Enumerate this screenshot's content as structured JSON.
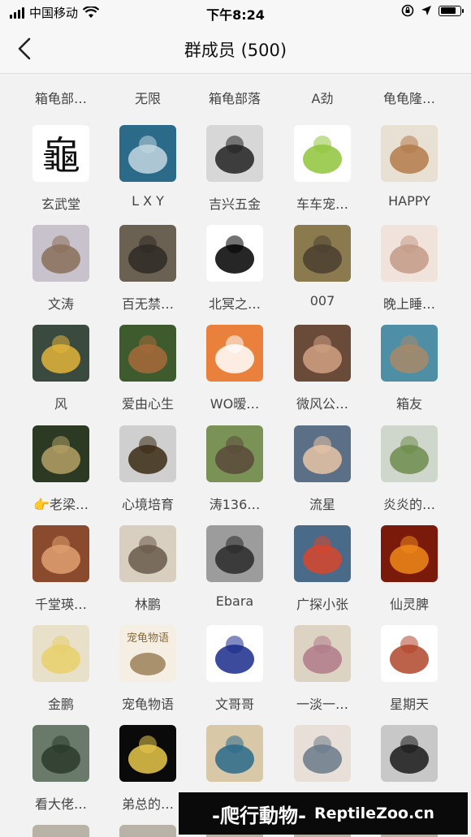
{
  "status_bar": {
    "carrier": "中国移动",
    "time": "下午8:24",
    "signal_bars": 4,
    "battery_level": 0.85
  },
  "nav": {
    "title": "群成员 (500)",
    "back_icon": "chevron-left-icon"
  },
  "members_top_partial": [
    "箱龟部…",
    "无限",
    "箱龟部落",
    "A劲",
    "龟龟隆…"
  ],
  "member_rows": [
    [
      {
        "name": "玄武堂",
        "colors": [
          "#ffffff",
          "#111111"
        ],
        "glyph": "龜"
      },
      {
        "name": "L X Y",
        "colors": [
          "#2b6a88",
          "#c3d7e0"
        ]
      },
      {
        "name": "吉兴五金",
        "colors": [
          "#d7d7d7",
          "#222222"
        ]
      },
      {
        "name": "车车宠…",
        "colors": [
          "#ffffff",
          "#8fc43a"
        ]
      },
      {
        "name": "HAPPY",
        "colors": [
          "#e7e0d3",
          "#b47a4a"
        ]
      }
    ],
    [
      {
        "name": "文涛",
        "colors": [
          "#c7c2cb",
          "#8a6f5a"
        ]
      },
      {
        "name": "百无禁…",
        "colors": [
          "#6b6152",
          "#2f2a26"
        ]
      },
      {
        "name": "北冥之…",
        "colors": [
          "#ffffff",
          "#000000"
        ]
      },
      {
        "name": "007",
        "colors": [
          "#8b7a4e",
          "#4a4030"
        ]
      },
      {
        "name": "晚上睡…",
        "colors": [
          "#efe3db",
          "#c49a87"
        ]
      }
    ],
    [
      {
        "name": "风",
        "colors": [
          "#3a4a3f",
          "#e3b43a"
        ]
      },
      {
        "name": "爱由心生",
        "colors": [
          "#3e5b2e",
          "#a86a3a"
        ]
      },
      {
        "name": "WO暧…",
        "colors": [
          "#e9813c",
          "#ffffff"
        ]
      },
      {
        "name": "微风公…",
        "colors": [
          "#6a4b3a",
          "#d0a183"
        ]
      },
      {
        "name": "箱友",
        "colors": [
          "#4e8fa6",
          "#a88967"
        ]
      }
    ],
    [
      {
        "name": "👉老梁…",
        "colors": [
          "#2c3a24",
          "#b5a066"
        ]
      },
      {
        "name": "心境培育",
        "colors": [
          "#cfcfcf",
          "#3a2a14"
        ]
      },
      {
        "name": "涛136…",
        "colors": [
          "#7a9256",
          "#5a4a3a"
        ]
      },
      {
        "name": "流星",
        "colors": [
          "#5b6f86",
          "#e8c5a5"
        ]
      },
      {
        "name": "炎炎的…",
        "colors": [
          "#cfd7cc",
          "#6d8c4b"
        ]
      }
    ],
    [
      {
        "name": "千堂瑛…",
        "colors": [
          "#8a4a2e",
          "#e0a070"
        ]
      },
      {
        "name": "林鹏",
        "colors": [
          "#d8cfc0",
          "#6a5a4a"
        ]
      },
      {
        "name": "Ebara",
        "colors": [
          "#9c9c9c",
          "#2a2a2a"
        ]
      },
      {
        "name": "广探小张",
        "colors": [
          "#4a6a8a",
          "#d8452a"
        ]
      },
      {
        "name": "仙灵脾",
        "colors": [
          "#7a1a0a",
          "#f08a1a"
        ]
      }
    ],
    [
      {
        "name": "金鹏",
        "colors": [
          "#e8e0c8",
          "#e8d06a"
        ]
      },
      {
        "name": "宠龟物语",
        "colors": [
          "#f5efe3",
          "#8a6a3a"
        ],
        "glyph": "宠龟物语"
      },
      {
        "name": "文哥哥",
        "colors": [
          "#ffffff",
          "#1a2c8a"
        ]
      },
      {
        "name": "一淡一…",
        "colors": [
          "#dcd3c2",
          "#b07a8a"
        ]
      },
      {
        "name": "星期天",
        "colors": [
          "#ffffff",
          "#b0452a"
        ]
      }
    ],
    [
      {
        "name": "看大佬…",
        "colors": [
          "#6a7a6a",
          "#2a3a2a"
        ]
      },
      {
        "name": "弟总的…",
        "colors": [
          "#0a0a0a",
          "#e8c84a"
        ]
      },
      {
        "name": "",
        "colors": [
          "#d8c8a8",
          "#2a6a8a"
        ]
      },
      {
        "name": "",
        "colors": [
          "#e8e0d8",
          "#6a7a8a"
        ]
      },
      {
        "name": "",
        "colors": [
          "#c8c8c8",
          "#1a1a1a"
        ]
      }
    ]
  ],
  "watermark": {
    "chinese": "-爬行動物-",
    "english": "ReptileZoo.cn"
  }
}
